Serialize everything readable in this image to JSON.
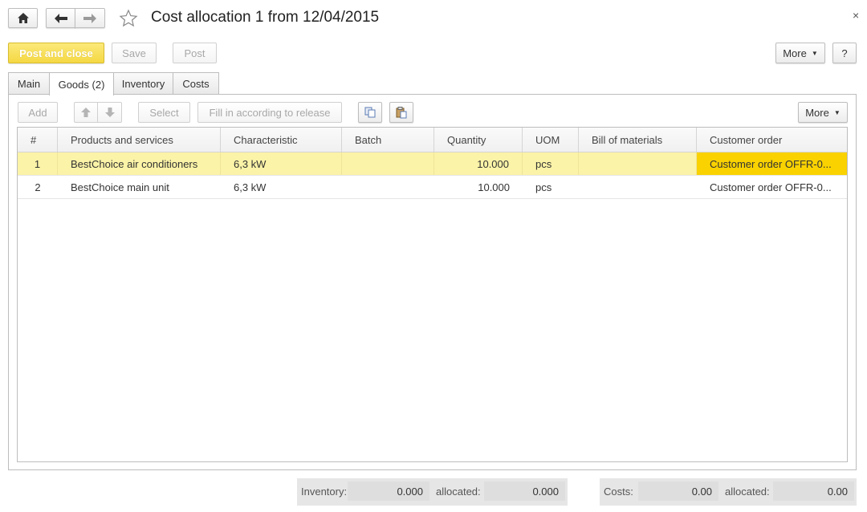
{
  "window": {
    "title": "Cost allocation 1 from 12/04/2015",
    "close_glyph": "×"
  },
  "nav": {
    "home_icon": "home-icon",
    "back_icon": "arrow-left-icon",
    "forward_icon": "arrow-right-icon",
    "favorite_icon": "star-icon"
  },
  "toolbar": {
    "post_and_close": "Post and close",
    "save": "Save",
    "post": "Post",
    "more": "More",
    "help": "?"
  },
  "tabs": [
    {
      "label": "Main"
    },
    {
      "label": "Goods (2)"
    },
    {
      "label": "Inventory"
    },
    {
      "label": "Costs"
    }
  ],
  "grid_toolbar": {
    "add": "Add",
    "select": "Select",
    "fill": "Fill in according to release",
    "more": "More"
  },
  "table": {
    "columns": [
      "#",
      "Products and services",
      "Characteristic",
      "Batch",
      "Quantity",
      "UOM",
      "Bill of materials",
      "Customer order"
    ],
    "rows": [
      {
        "n": "1",
        "product": "BestChoice air conditioners",
        "characteristic": "6,3 kW",
        "batch": "",
        "quantity": "10.000",
        "uom": "pcs",
        "bom": "",
        "order": "Customer order OFFR-0..."
      },
      {
        "n": "2",
        "product": "BestChoice main unit",
        "characteristic": "6,3 kW",
        "batch": "",
        "quantity": "10.000",
        "uom": "pcs",
        "bom": "",
        "order": "Customer order OFFR-0..."
      }
    ]
  },
  "footer": {
    "inventory_label": "Inventory:",
    "inventory_value": "0.000",
    "inventory_allocated_label": "allocated:",
    "inventory_allocated_value": "0.000",
    "costs_label": "Costs:",
    "costs_value": "0.00",
    "costs_allocated_label": "allocated:",
    "costs_allocated_value": "0.00"
  },
  "colors": {
    "primary_button": "#f5d843",
    "selected_row": "#fbf3a7",
    "focused_cell": "#f9d200"
  }
}
